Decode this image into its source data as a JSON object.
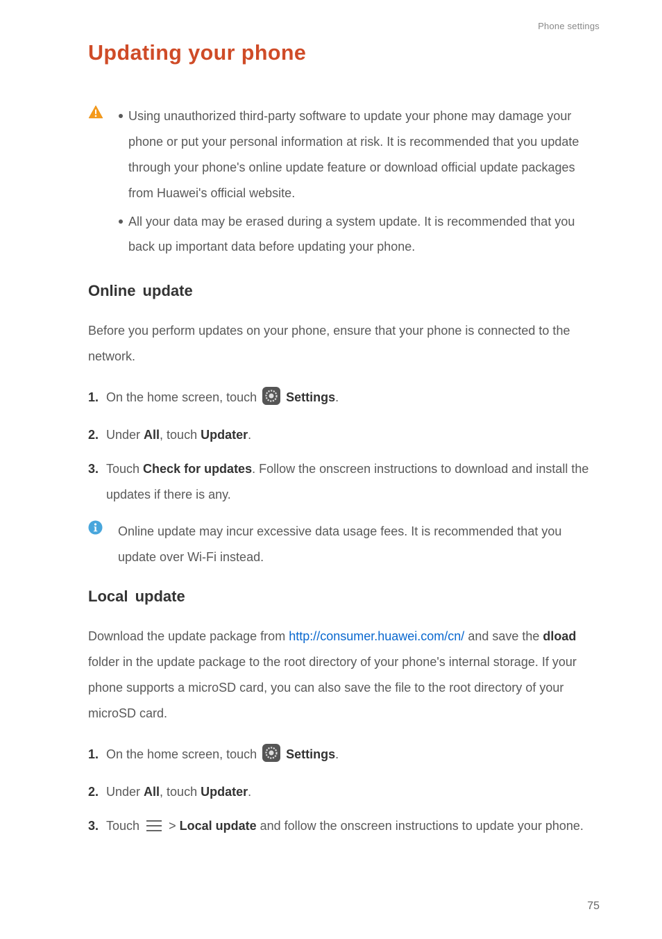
{
  "page_header": "Phone settings",
  "title": "Updating your phone",
  "warning": {
    "items": [
      "Using unauthorized third-party software to update your phone may damage your phone or put your personal information at risk. It is recommended that you update through your phone's online update feature or download official update packages from Huawei's official website.",
      "All your data may be erased during a system update. It is recommended that you back up important data before updating your phone."
    ]
  },
  "online_update": {
    "heading": "Online  update",
    "intro": "Before you perform updates on your phone, ensure that your phone is connected to the network.",
    "steps": {
      "s1_a": "On the home screen, touch ",
      "s1_b": "Settings",
      "s1_c": ".",
      "s2_a": "Under ",
      "s2_b": "All",
      "s2_c": ", touch ",
      "s2_d": "Updater",
      "s2_e": ".",
      "s3_a": "Touch ",
      "s3_b": "Check for updates",
      "s3_c": ". Follow the onscreen instructions to download and install the updates if there is any."
    },
    "info": "Online update may incur excessive data usage fees. It is recommended that you update over Wi-Fi instead."
  },
  "local_update": {
    "heading": "Local  update",
    "intro_a": "Download the update package from ",
    "intro_link": "http://consumer.huawei.com/cn/",
    "intro_b": " and save the ",
    "intro_bold": "dload",
    "intro_c": " folder in the update package to the root directory of your phone's internal storage. If your phone supports a microSD card, you can also save the file to the root directory of your microSD card.",
    "steps": {
      "s1_a": "On the home screen, touch ",
      "s1_b": "Settings",
      "s1_c": ".",
      "s2_a": "Under ",
      "s2_b": "All",
      "s2_c": ", touch ",
      "s2_d": "Updater",
      "s2_e": ".",
      "s3_a": "Touch ",
      "s3_b": " > ",
      "s3_c": "Local update",
      "s3_d": " and follow the onscreen instructions to update your phone."
    }
  },
  "page_number": "75"
}
